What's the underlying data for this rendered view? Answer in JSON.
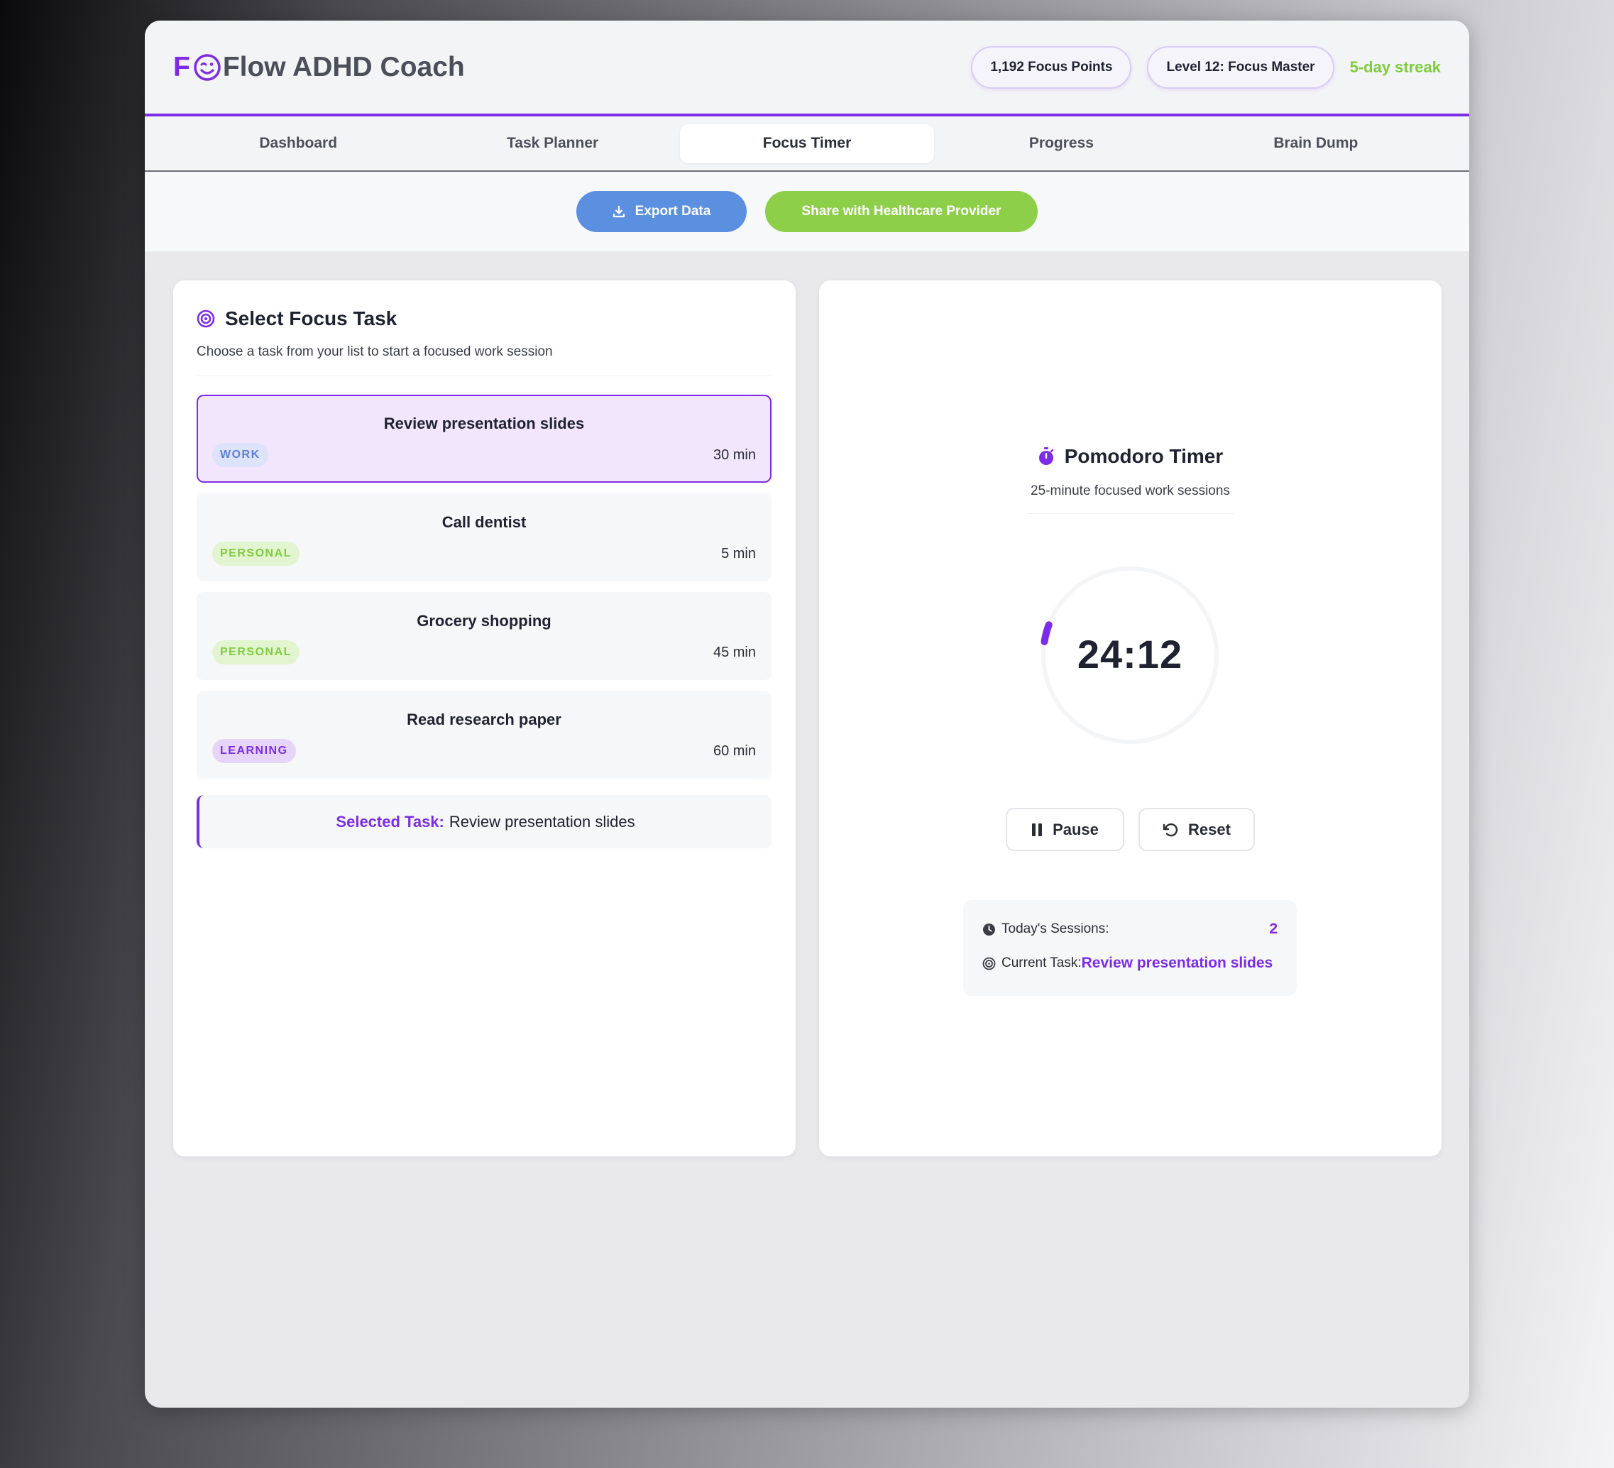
{
  "header": {
    "logo_letter": "F",
    "logo_text": "Flow ADHD Coach",
    "focus_points": "1,192 Focus Points",
    "level": "Level 12: Focus Master",
    "streak": "5-day streak"
  },
  "nav": {
    "tabs": [
      {
        "label": "Dashboard"
      },
      {
        "label": "Task Planner"
      },
      {
        "label": "Focus Timer",
        "active": true
      },
      {
        "label": "Progress"
      },
      {
        "label": "Brain Dump"
      }
    ]
  },
  "actions": {
    "export_label": "Export Data",
    "share_label": "Share with Healthcare Provider"
  },
  "focus_task": {
    "title": "Select Focus Task",
    "subtitle": "Choose a task from your list to start a focused work session",
    "tasks": [
      {
        "name": "Review presentation slides",
        "tag": "WORK",
        "duration": "30 min",
        "selected": true
      },
      {
        "name": "Call dentist",
        "tag": "PERSONAL",
        "duration": "5 min"
      },
      {
        "name": "Grocery shopping",
        "tag": "PERSONAL",
        "duration": "45 min"
      },
      {
        "name": "Read research paper",
        "tag": "LEARNING",
        "duration": "60 min"
      }
    ],
    "selected_label": "Selected Task:",
    "selected_value": "Review presentation slides"
  },
  "timer": {
    "title": "Pomodoro Timer",
    "subtitle": "25-minute focused work sessions",
    "time": "24:12",
    "progress_fraction": 0.032,
    "pause_label": "Pause",
    "reset_label": "Reset",
    "sessions_label": "Today's Sessions:",
    "sessions_value": "2",
    "current_task_label": "Current Task:",
    "current_task_value": "Review presentation slides"
  },
  "colors": {
    "accent": "#7c2ce6",
    "export": "#5b8fe0",
    "share": "#8ecf4a",
    "streak": "#7fcc3e"
  }
}
